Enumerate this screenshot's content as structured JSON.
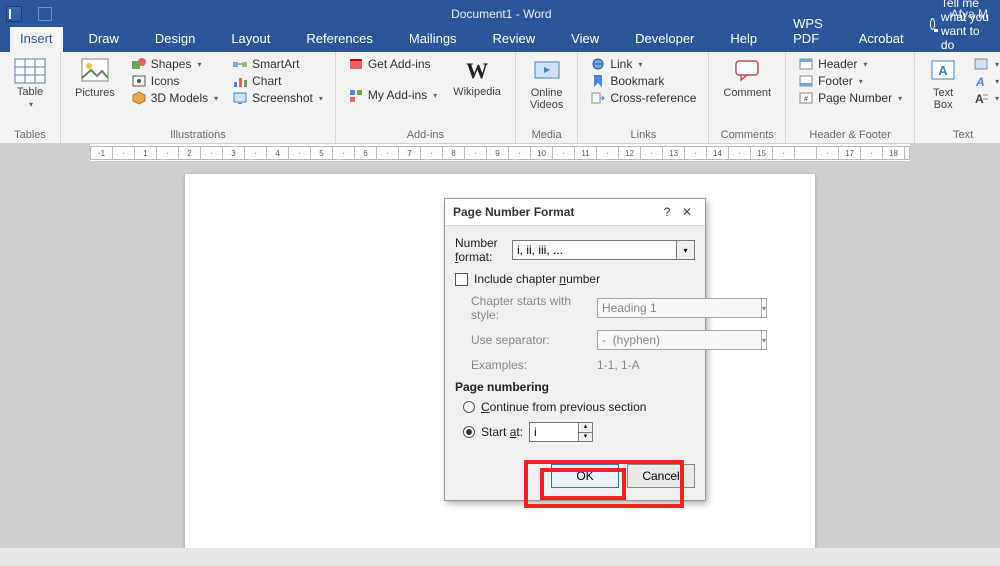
{
  "window": {
    "title": "Document1 - Word",
    "user": "Afya M"
  },
  "tabs": [
    "Insert",
    "Draw",
    "Design",
    "Layout",
    "References",
    "Mailings",
    "Review",
    "View",
    "Developer",
    "Help",
    "WPS PDF",
    "Acrobat"
  ],
  "tell_me": "Tell me what you want to do",
  "ribbon": {
    "tables": {
      "label": "Tables",
      "table_btn": "Table"
    },
    "illustrations": {
      "label": "Illustrations",
      "pictures": "Pictures",
      "shapes": "Shapes",
      "icons": "Icons",
      "models": "3D Models",
      "smartart": "SmartArt",
      "chart": "Chart",
      "screenshot": "Screenshot"
    },
    "addins": {
      "label": "Add-ins",
      "get": "Get Add-ins",
      "my": "My Add-ins",
      "wiki": "Wikipedia"
    },
    "media": {
      "label": "Media",
      "online": "Online\nVideos"
    },
    "links": {
      "label": "Links",
      "link": "Link",
      "bookmark": "Bookmark",
      "crossref": "Cross-reference"
    },
    "comments": {
      "label": "Comments",
      "comment": "Comment"
    },
    "headerfooter": {
      "label": "Header & Footer",
      "header": "Header",
      "footer": "Footer",
      "page_number": "Page Number"
    },
    "text": {
      "label": "Text",
      "textbox": "Text\nBox"
    }
  },
  "ruler": [
    "-1",
    "·",
    "1",
    "·",
    "2",
    "·",
    "3",
    "·",
    "4",
    "·",
    "5",
    "·",
    "6",
    "·",
    "7",
    "·",
    "8",
    "·",
    "9",
    "·",
    "10",
    "·",
    "11",
    "·",
    "12",
    "·",
    "13",
    "·",
    "14",
    "·",
    "15",
    "·",
    "",
    "·",
    "17",
    "·",
    "18"
  ],
  "dialog": {
    "title": "Page Number Format",
    "number_format_label": "Number format:",
    "number_format_value": "i, ii, iii, ...",
    "include_chapter": "Include chapter number",
    "chapter_style_label": "Chapter starts with style:",
    "chapter_style_value": "Heading 1",
    "separator_label": "Use separator:",
    "separator_value": "-  (hyphen)",
    "examples_label": "Examples:",
    "examples_value": "1-1, 1-A",
    "page_numbering": "Page numbering",
    "continue": "Continue from previous section",
    "start_at_label": "Start at:",
    "start_at_value": "i",
    "ok": "OK",
    "cancel": "Cancel"
  }
}
